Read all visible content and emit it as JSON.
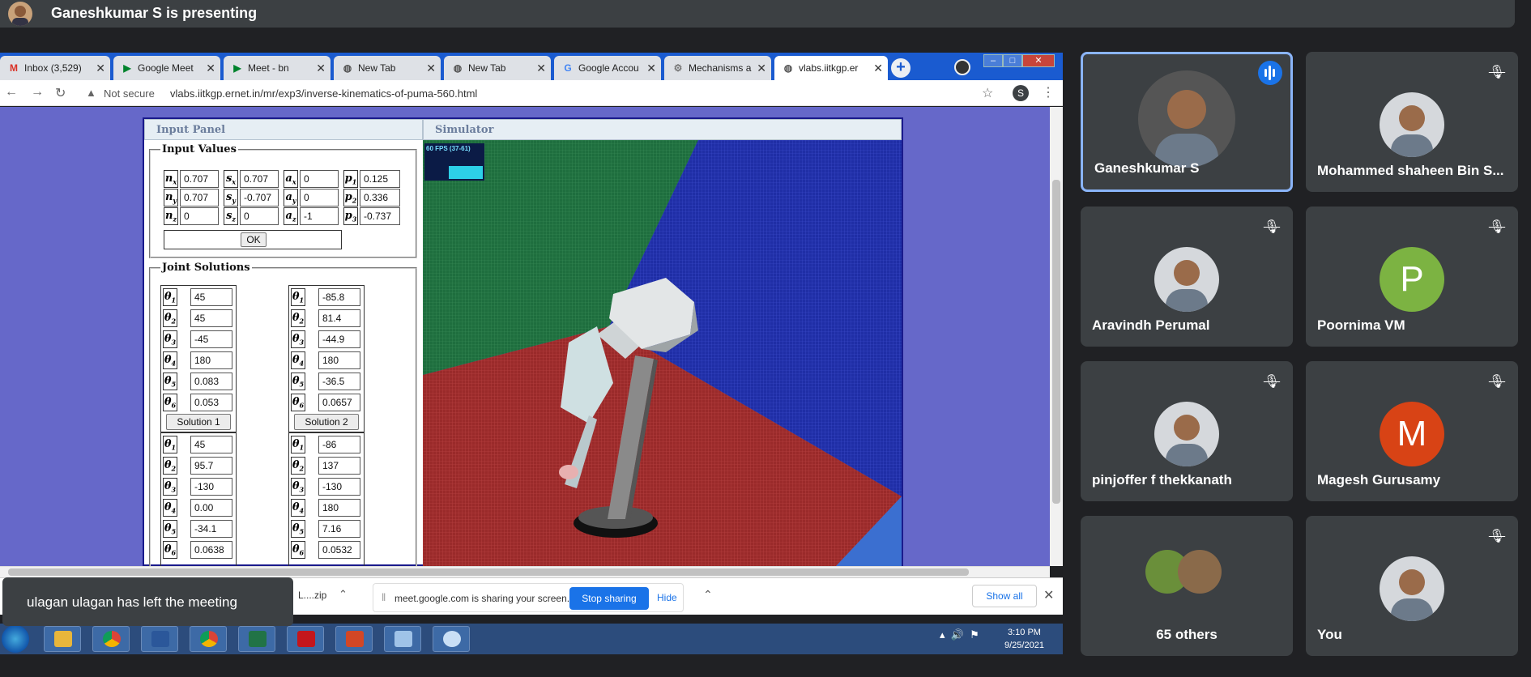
{
  "presenter_bar": {
    "text": "Ganeshkumar S is presenting"
  },
  "browser": {
    "tabs": [
      {
        "label": "Inbox (3,529)",
        "icon": "gmail-icon"
      },
      {
        "label": "Google Meet",
        "icon": "meet-icon"
      },
      {
        "label": "Meet - bn",
        "icon": "meet-icon"
      },
      {
        "label": "New Tab",
        "icon": "globe-icon"
      },
      {
        "label": "New Tab",
        "icon": "globe-icon"
      },
      {
        "label": "Google Accou",
        "icon": "google-icon"
      },
      {
        "label": "Mechanisms a",
        "icon": "mechanism-icon"
      },
      {
        "label": "vlabs.iitkgp.er",
        "icon": "globe-icon"
      }
    ],
    "not_secure": "Not secure",
    "url": "vlabs.iitkgp.ernet.in/mr/exp3/inverse-kinematics-of-puma-560.html",
    "profile_initial": "S"
  },
  "page": {
    "input_panel_title": "Input Panel",
    "simulator_title": "Simulator",
    "input_values_legend": "Input Values",
    "inputs": [
      [
        {
          "label": "n",
          "sub": "x",
          "value": "0.707"
        },
        {
          "label": "s",
          "sub": "x",
          "value": "0.707"
        },
        {
          "label": "a",
          "sub": "x",
          "value": "0"
        },
        {
          "label": "p",
          "sub": "1",
          "value": "0.125"
        }
      ],
      [
        {
          "label": "n",
          "sub": "y",
          "value": "0.707"
        },
        {
          "label": "s",
          "sub": "y",
          "value": "-0.707"
        },
        {
          "label": "a",
          "sub": "y",
          "value": "0"
        },
        {
          "label": "p",
          "sub": "2",
          "value": "0.336"
        }
      ],
      [
        {
          "label": "n",
          "sub": "z",
          "value": "0"
        },
        {
          "label": "s",
          "sub": "z",
          "value": "0"
        },
        {
          "label": "a",
          "sub": "z",
          "value": "-1"
        },
        {
          "label": "p",
          "sub": "3",
          "value": "-0.737"
        }
      ]
    ],
    "ok_label": "OK",
    "joint_solutions_legend": "Joint Solutions",
    "theta_symbol": "θ",
    "solutions": [
      {
        "values": [
          "45",
          "45",
          "-45",
          "180",
          "0.083",
          "0.053"
        ],
        "button": "Solution 1"
      },
      {
        "values": [
          "-85.8",
          "81.4",
          "-44.9",
          "180",
          "-36.5",
          "0.0657"
        ],
        "button": "Solution 2"
      },
      {
        "values": [
          "45",
          "95.7",
          "-130",
          "0.00",
          "-34.1",
          "0.0638"
        ],
        "button": ""
      },
      {
        "values": [
          "-86",
          "137",
          "-130",
          "180",
          "7.16",
          "0.0532"
        ],
        "button": ""
      }
    ],
    "fps_label": "60 FPS (37-61)"
  },
  "download_bar": {
    "file_label": "L....zip",
    "share_text": "meet.google.com is sharing your screen.",
    "stop_sharing": "Stop sharing",
    "hide": "Hide",
    "show_all": "Show all"
  },
  "taskbar": {
    "time": "3:10 PM",
    "date": "9/25/2021"
  },
  "toast": {
    "text": "ulagan ulagan has left the meeting"
  },
  "participants": [
    {
      "name": "Ganeshkumar S",
      "state": "speaking"
    },
    {
      "name": "Mohammed shaheen Bin S...",
      "state": "muted"
    },
    {
      "name": "Aravindh Perumal",
      "state": "muted"
    },
    {
      "name": "Poornima VM",
      "state": "muted",
      "letter": "P",
      "color": "#7cb342"
    },
    {
      "name": "pinjoffer f thekkanath",
      "state": "muted"
    },
    {
      "name": "Magesh Gurusamy",
      "state": "muted",
      "letter": "M",
      "color": "#d84315"
    },
    {
      "name": "65 others",
      "state": "group"
    },
    {
      "name": "You",
      "state": "muted"
    }
  ]
}
